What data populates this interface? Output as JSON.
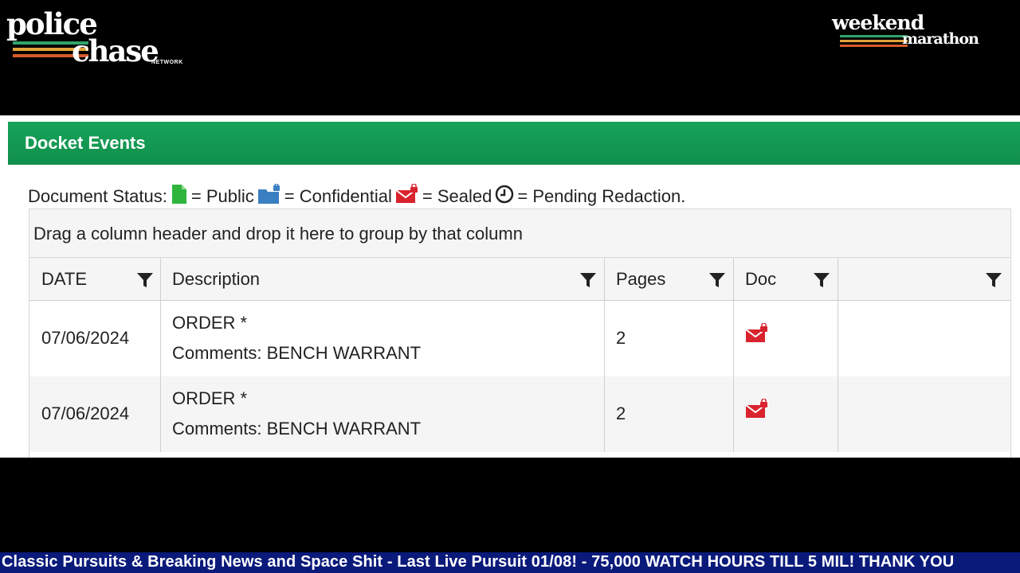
{
  "overlay": {
    "logo_left": {
      "word1": "police",
      "word2": "chase",
      "word3": "NETWORK"
    },
    "logo_right": {
      "word1": "weekend",
      "word2": "marathon"
    },
    "stripe_colors": [
      "#2fa36b",
      "#e2a33a",
      "#d65a2a"
    ],
    "ticker_text": "Classic Pursuits & Breaking News and Space Shit - Last Live Pursuit 01/08! - 75,000 WATCH HOURS TILL 5 MIL! THANK YOU"
  },
  "panel": {
    "title": "Docket Events",
    "header_color": "#16a05a",
    "status_legend": {
      "prefix": "Document Status:",
      "public": "= Public",
      "confidential": "= Confidential",
      "sealed": "= Sealed",
      "pending": "= Pending Redaction."
    },
    "group_hint": "Drag a column header and drop it here to group by that column",
    "columns": [
      "DATE",
      "Description",
      "Pages",
      "Doc",
      ""
    ],
    "rows": [
      {
        "date": "07/06/2024",
        "desc1": "ORDER *",
        "desc2": "Comments: BENCH WARRANT",
        "pages": "2",
        "doc": "sealed-icon"
      },
      {
        "date": "07/06/2024",
        "desc1": "ORDER *",
        "desc2": "Comments: BENCH WARRANT",
        "pages": "2",
        "doc": "sealed-icon"
      }
    ]
  }
}
